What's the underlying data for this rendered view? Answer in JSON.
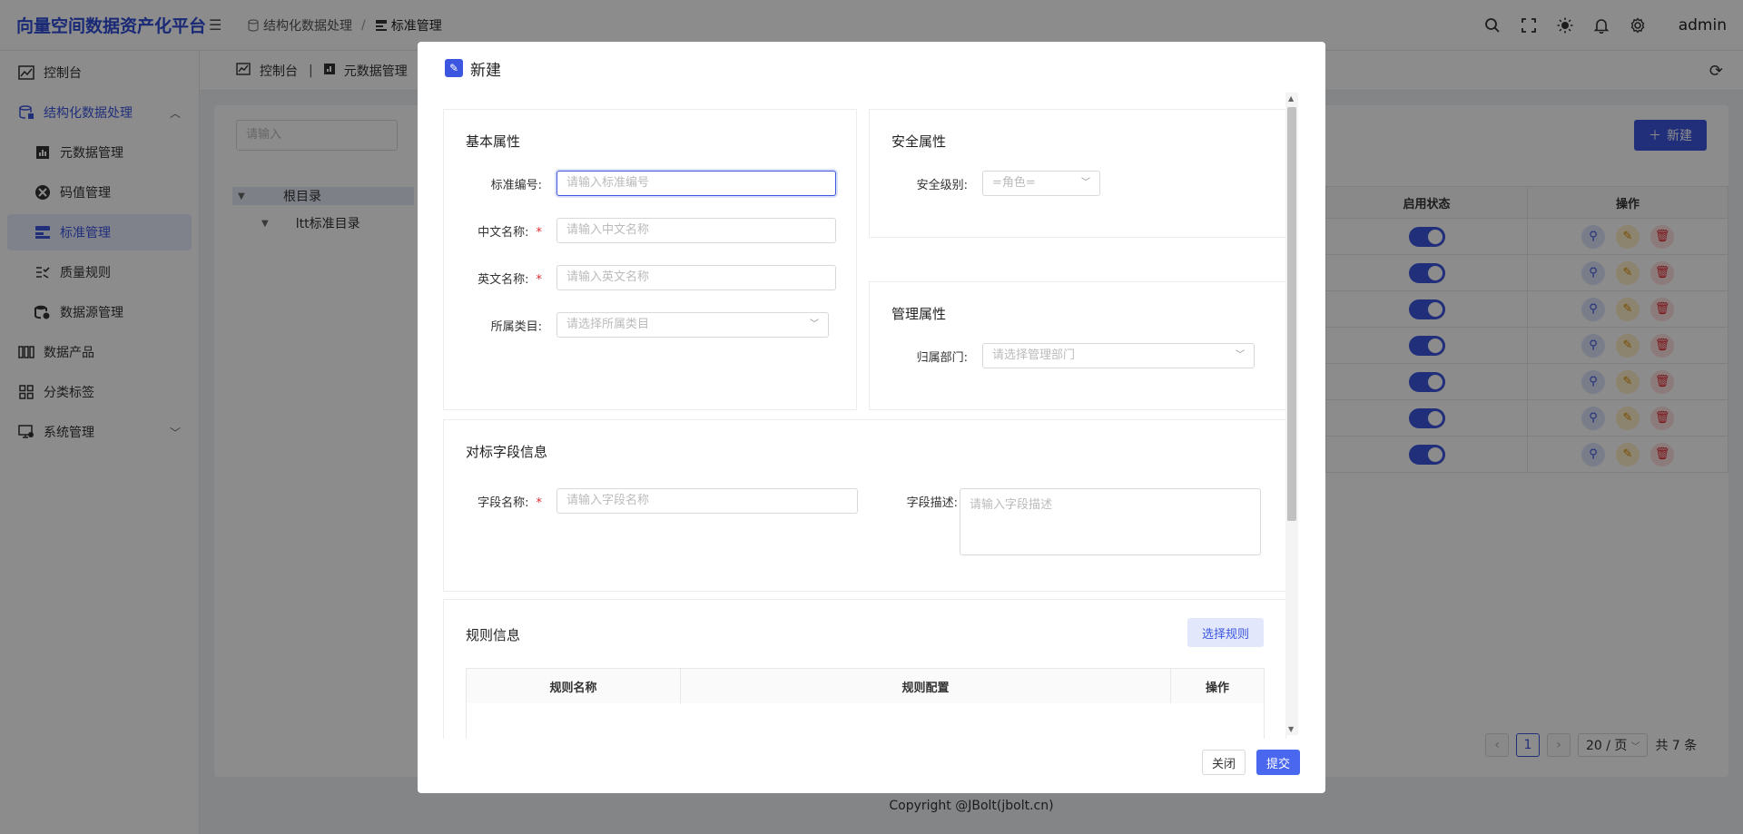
{
  "app": {
    "brand": "向量空间数据资产化平台",
    "user": "admin"
  },
  "breadcrumb": {
    "parent": "结构化数据处理",
    "separator": "/",
    "current": "标准管理"
  },
  "sidebar": {
    "items": [
      {
        "label": "控制台",
        "icon": "dashboard-icon"
      },
      {
        "label": "结构化数据处理",
        "icon": "database-icon"
      },
      {
        "label": "元数据管理",
        "icon": "chart-icon"
      },
      {
        "label": "码值管理",
        "icon": "code-icon"
      },
      {
        "label": "标准管理",
        "icon": "standard-icon"
      },
      {
        "label": "质量规则",
        "icon": "rule-icon"
      },
      {
        "label": "数据源管理",
        "icon": "datasource-icon"
      },
      {
        "label": "数据产品",
        "icon": "product-icon"
      },
      {
        "label": "分类标签",
        "icon": "grid-icon"
      },
      {
        "label": "系统管理",
        "icon": "settings-icon"
      }
    ]
  },
  "tabs": [
    {
      "label": "控制台"
    },
    {
      "label": "元数据管理"
    }
  ],
  "background": {
    "search_placeholder": "请输入",
    "new_button": "新建",
    "tree": {
      "root": "根目录",
      "child": "ltt标准目录"
    },
    "table": {
      "headers": [
        "启用状态",
        "操作"
      ],
      "row_count": 7
    },
    "pager": {
      "page": "1",
      "page_size": "20 / 页",
      "total": "共 7 条"
    }
  },
  "footer": "Copyright @JBolt(jbolt.cn)",
  "modal": {
    "title": "新建",
    "basic": {
      "title": "基本属性",
      "code_label": "标准编号:",
      "code_placeholder": "请输入标准编号",
      "cn_label": "中文名称:",
      "cn_placeholder": "请输入中文名称",
      "en_label": "英文名称:",
      "en_placeholder": "请输入英文名称",
      "category_label": "所属类目:",
      "category_placeholder": "请选择所属类目",
      "required_mark": "*"
    },
    "security": {
      "title": "安全属性",
      "level_label": "安全级别:",
      "level_value": "=角色="
    },
    "management": {
      "title": "管理属性",
      "dept_label": "归属部门:",
      "dept_placeholder": "请选择管理部门"
    },
    "field": {
      "title": "对标字段信息",
      "name_label": "字段名称:",
      "name_placeholder": "请输入字段名称",
      "desc_label": "字段描述:",
      "desc_placeholder": "请输入字段描述"
    },
    "rules": {
      "title": "规则信息",
      "select_button": "选择规则",
      "headers": [
        "规则名称",
        "规则配置",
        "操作"
      ]
    },
    "close_button": "关闭",
    "submit_button": "提交"
  }
}
